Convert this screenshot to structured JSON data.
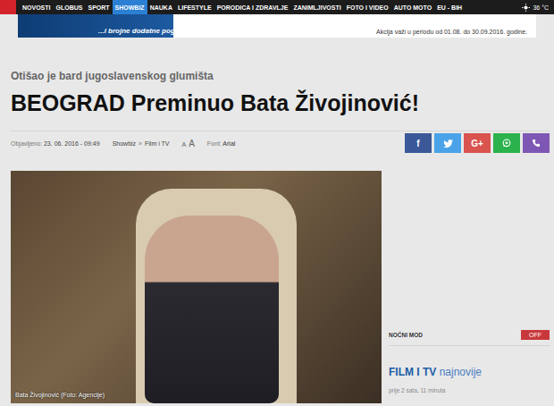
{
  "nav": {
    "items": [
      {
        "label": "NOVOSTI",
        "selected": false
      },
      {
        "label": "GLOBUS",
        "selected": false
      },
      {
        "label": "SPORT",
        "selected": false
      },
      {
        "label": "SHOWBIZ",
        "selected": true
      },
      {
        "label": "NAUKA",
        "selected": false
      },
      {
        "label": "LIFESTYLE",
        "selected": false
      },
      {
        "label": "PORODICA I ZDRAVLJE",
        "selected": false
      },
      {
        "label": "ZANIMLJIVOSTI",
        "selected": false
      },
      {
        "label": "FOTO I VIDEO",
        "selected": false
      },
      {
        "label": "AUTO MOTO",
        "selected": false
      },
      {
        "label": "EU - BIH",
        "selected": false
      }
    ],
    "weather": "36 °C"
  },
  "banner": {
    "slogan": "...i brojne dodatne pog",
    "notice": "Akcija važi u periodu od 01.08. do 30.09.2016. godine."
  },
  "article": {
    "kicker": "Otišao je bard jugoslavenskog glumišta",
    "title": "BEOGRAD Preminuo Bata Živojinović!",
    "published_label": "Objavljeno:",
    "published": "23. 06. 2016 - 09:49",
    "breadcrumb": [
      "Showbiz",
      "Film i TV"
    ],
    "breadcrumb_sep": "»",
    "font_sizes": [
      "A",
      "A"
    ],
    "font_label": "Font:",
    "font_value": "Arial",
    "share": [
      {
        "kind": "facebook",
        "label": "f",
        "color": "#3b5998"
      },
      {
        "kind": "twitter",
        "color": "#4aa3e8"
      },
      {
        "kind": "google",
        "label": "G+",
        "color": "#d9534f"
      },
      {
        "kind": "whatsapp",
        "color": "#2bb24c"
      },
      {
        "kind": "viber",
        "color": "#7e57b5"
      }
    ]
  },
  "photo": {
    "caption": "Bata Živojinović (Foto: Agencije)"
  },
  "sidebar": {
    "night_mode": {
      "label": "NOĆNI MOD",
      "button": "OFF",
      "on": false
    },
    "section": {
      "title": "FILM I TV",
      "suffix": "najnovije"
    },
    "latest": [
      {
        "time": "prije 2 sata, 11 minuta"
      }
    ]
  }
}
